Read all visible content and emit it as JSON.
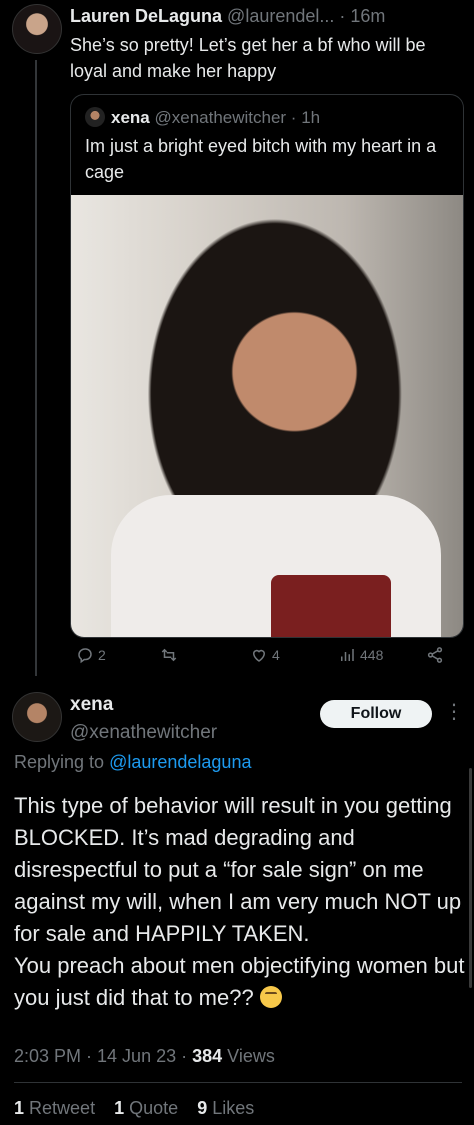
{
  "reply_tweet": {
    "name": "Lauren DeLaguna",
    "handle": "@laurendel...",
    "time": "· 16m",
    "text": "She’s so pretty! Let’s get her a bf who will be loyal and make her happy"
  },
  "quote": {
    "name": "xena",
    "handle": "@xenathewitcher · 1h",
    "text": "Im just a bright eyed bitch with my heart in a cage"
  },
  "actions": {
    "replies": "2",
    "retweets": "",
    "likes": "4",
    "views": "448"
  },
  "main_tweet": {
    "name": "xena",
    "handle": "@xenathewitcher",
    "follow_label": "Follow",
    "replying_to_label": "Replying to",
    "replying_to_handle": "@laurendelaguna",
    "text": "This type of behavior will result in you getting BLOCKED. It’s mad degrading and disrespectful to put a “for sale sign” on me against my will, when I am very much NOT up for sale and HAPPILY TAKEN.\nYou preach about men objectifying women but you just did that to me??",
    "emoji": "thinking-face-emoji",
    "timestamp": "2:03 PM · 14 Jun 23 ·",
    "views_count": "384",
    "views_label": "Views"
  },
  "stats": {
    "retweets_count": "1",
    "retweets_label": "Retweet",
    "quotes_count": "1",
    "quotes_label": "Quote",
    "likes_count": "9",
    "likes_label": "Likes"
  },
  "colors": {
    "background": "#000000",
    "text": "#e7e9ea",
    "muted": "#71767b",
    "link": "#1d9bf0"
  }
}
